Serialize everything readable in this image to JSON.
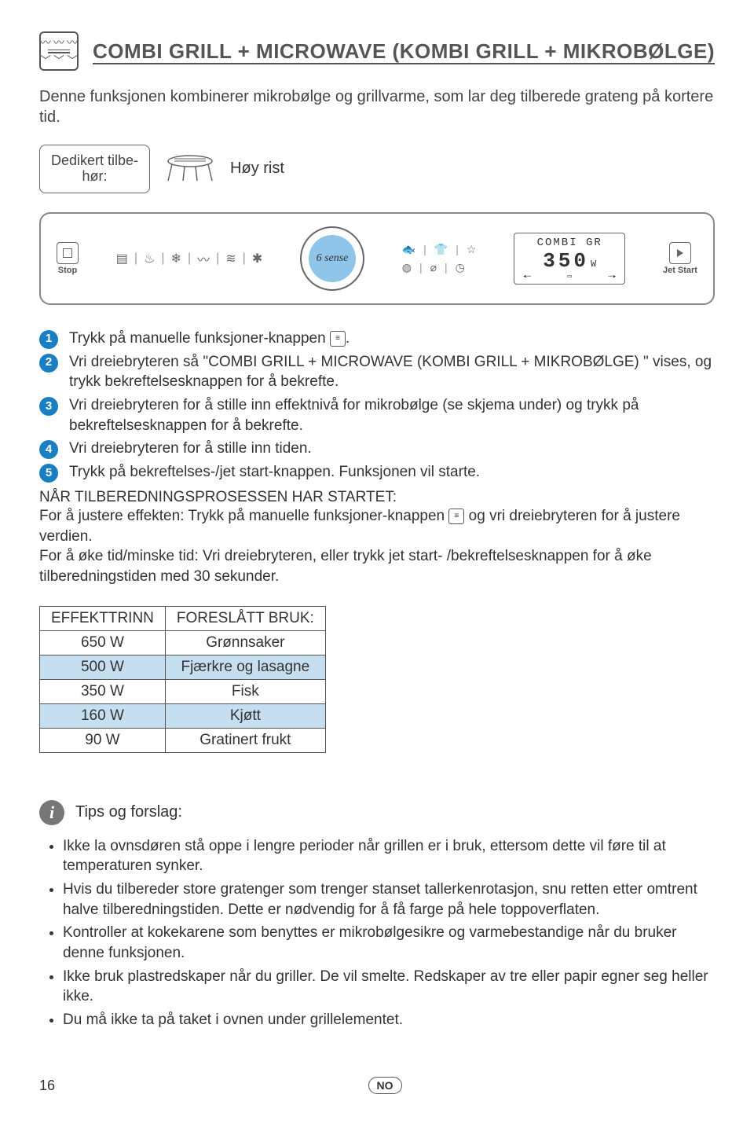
{
  "header": {
    "title": "COMBI GRILL + MICROWAVE (KOMBI GRILL + MIKROBØLGE)"
  },
  "intro": "Denne funksjonen kombinerer mikrobølge og grillvarme, som lar deg tilberede grateng på kortere tid.",
  "accessory": {
    "label_line1": "Dedikert tilbe-",
    "label_line2": "hør:",
    "name": "Høy rist"
  },
  "panel": {
    "stop_label": "Stop",
    "dial_text": "6 sense",
    "display_title": "COMBI GR",
    "display_value": "350",
    "display_unit": "W",
    "jet_label": "Jet Start"
  },
  "steps": [
    {
      "n": "1",
      "prefix": "Trykk på manuelle funksjoner-knappen ",
      "suffix": "."
    },
    {
      "n": "2",
      "text": "Vri dreiebryteren så \"COMBI GRILL + MICROWAVE (KOMBI GRILL + MIKROBØLGE) \" vises, og trykk bekreftelsesknappen for å bekrefte."
    },
    {
      "n": "3",
      "text": "Vri dreiebryteren for å stille inn effektnivå for mikrobølge (se skjema under) og trykk på bekreftelsesknappen for å bekrefte."
    },
    {
      "n": "4",
      "text": "Vri dreiebryteren for å stille inn tiden."
    },
    {
      "n": "5",
      "text": "Trykk på bekreftelses-/jet start-knappen. Funksjonen vil starte."
    }
  ],
  "started": {
    "heading": "NÅR TILBEREDNINGSPROSESSEN HAR STARTET:",
    "line1_prefix": "For å justere effekten: Trykk på manuelle funksjoner-knappen ",
    "line1_suffix": " og vri dreiebryteren for å justere verdien.",
    "line2": "For å øke tid/minske tid: Vri dreiebryteren, eller trykk jet start- /bekreftelsesknappen for å øke tilberedningstiden med 30 sekunder."
  },
  "table": {
    "head1": "EFFEKTTRINN",
    "head2": "FORESLÅTT BRUK:",
    "rows": [
      {
        "w": "650 W",
        "use": "Grønnsaker",
        "shade": false
      },
      {
        "w": "500 W",
        "use": "Fjærkre og lasagne",
        "shade": true
      },
      {
        "w": "350 W",
        "use": "Fisk",
        "shade": false
      },
      {
        "w": "160 W",
        "use": "Kjøtt",
        "shade": true
      },
      {
        "w": "90 W",
        "use": "Gratinert frukt",
        "shade": false
      }
    ]
  },
  "tips": {
    "title": "Tips og forslag:",
    "items": [
      "Ikke la ovnsdøren stå oppe i lengre perioder når grillen er i bruk, ettersom dette vil føre til at temperaturen synker.",
      "Hvis du tilbereder store gratenger som trenger stanset tallerkenrotasjon, snu retten etter omtrent halve tilberedningstiden. Dette er nødvendig for å få farge på hele toppoverflaten.",
      "Kontroller at kokekarene som benyttes er mikrobølgesikre og varmebestandige når du bruker denne funksjonen.",
      "Ikke bruk plastredskaper når du griller. De vil smelte. Redskaper av tre eller papir egner seg heller ikke.",
      "Du må ikke ta på taket i ovnen under grillelementet."
    ]
  },
  "footer": {
    "page": "16",
    "lang": "NO"
  }
}
